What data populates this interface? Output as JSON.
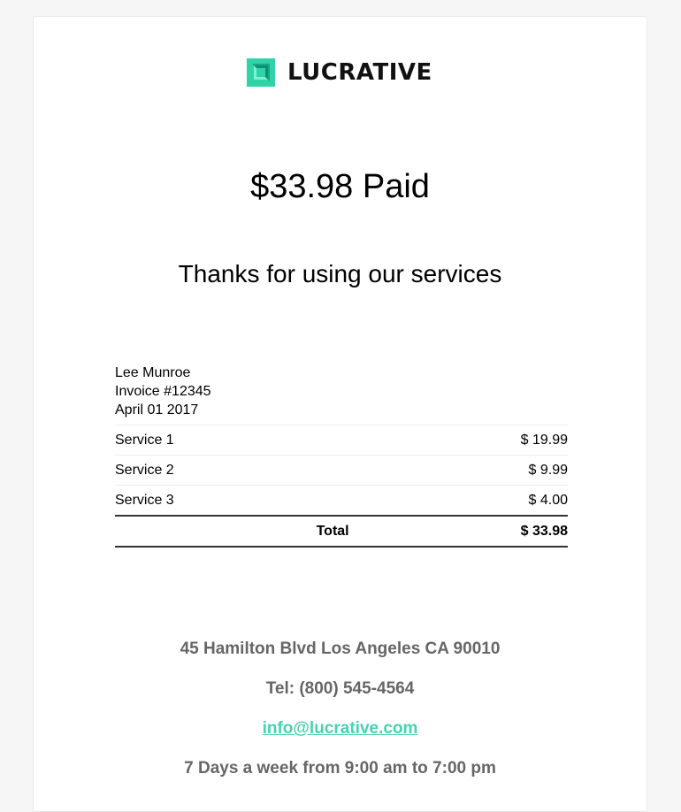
{
  "brand": {
    "name": "LUCRATIVE",
    "accent_color": "#2fd3a7",
    "logo_icon": "lucrative-square-logo"
  },
  "headline": {
    "amount_paid": "$33.98 Paid",
    "thanks": "Thanks for using our services"
  },
  "invoice": {
    "customer": "Lee Munroe",
    "number": "Invoice #12345",
    "date": "April 01 2017",
    "items": [
      {
        "name": "Service 1",
        "amount": "$ 19.99"
      },
      {
        "name": "Service 2",
        "amount": "$ 9.99"
      },
      {
        "name": "Service 3",
        "amount": "$ 4.00"
      }
    ],
    "total_label": "Total",
    "total_amount": "$ 33.98"
  },
  "footer": {
    "address": "45 Hamilton Blvd Los Angeles CA 90010",
    "phone": "Tel: (800) 545-4564",
    "email": "info@lucrative.com",
    "email_color": "#48d1b2",
    "hours": "7 Days a week from 9:00 am to 7:00 pm"
  }
}
